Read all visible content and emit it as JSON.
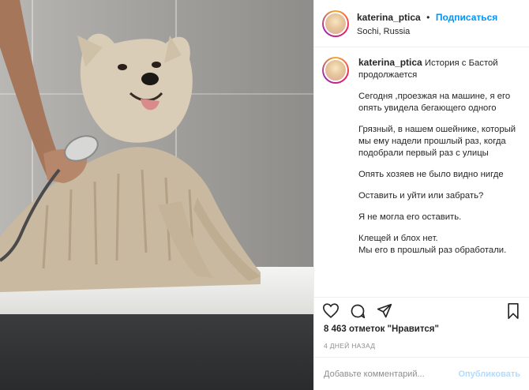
{
  "post": {
    "username": "katerina_ptica",
    "follow_label": "Подписаться",
    "separator": "•",
    "location": "Sochi, Russia",
    "photo_alt": "wet samoyed dog in bathtub",
    "caption_username": "katerina_ptica",
    "caption_paragraphs": [
      "История с Бастой продолжается",
      "Сегодня ,проезжая на машине, я его опять увидела бегающего одного",
      "Грязный, в нашем ошейнике, который мы ему надели прошлый раз, когда подобрали первый раз с улицы",
      "Опять хозяев не было видно нигде",
      "Оставить и уйти или забрать?",
      "Я не могла его оставить.",
      "Клещей и блох нет.",
      "Мы его в прошлый раз обработали."
    ],
    "likes": "8 463 отметок \"Нравится\"",
    "time_ago": "4 ДНЕЙ НАЗАД",
    "comment_placeholder": "Добавьте комментарий...",
    "publish_label": "Опубликовать"
  },
  "icons": {
    "like": "heart-icon",
    "comment": "comment-icon",
    "share": "share-icon",
    "save": "bookmark-icon"
  },
  "colors": {
    "accent": "#0095f6",
    "publish_disabled": "#b3dbff",
    "text": "#262626",
    "muted": "#8e8e8e"
  }
}
